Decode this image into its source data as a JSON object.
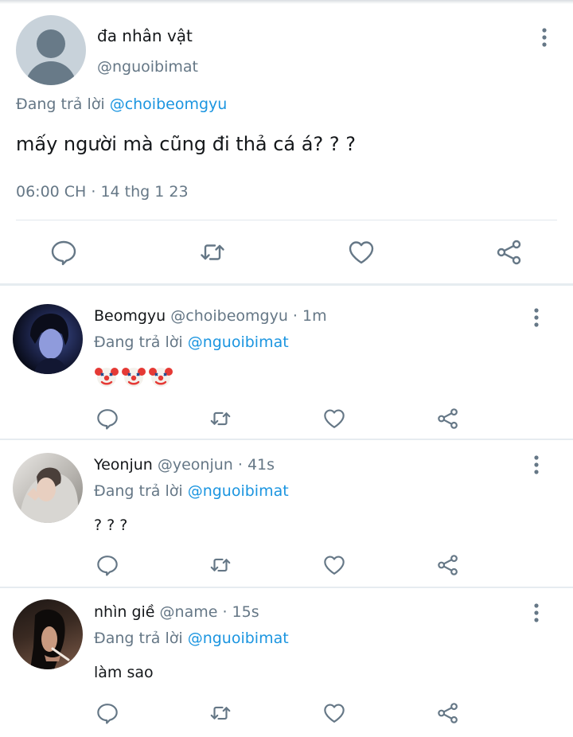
{
  "main_tweet": {
    "display_name": "đa nhân vật",
    "handle": "@nguoibimat",
    "reply_prefix": "Đang trả lời",
    "reply_to": "@choibeomgyu",
    "text": "mấy người mà cũng đi thả cá á? ? ?",
    "timestamp": "06:00 CH · 14 thg 1 23"
  },
  "replies": [
    {
      "display_name": "Beomgyu",
      "meta": "@choibeomgyu · 1m",
      "reply_prefix": "Đang trả lời",
      "reply_to": "@nguoibimat",
      "text": "",
      "emoji": [
        "clown-face",
        "clown-face",
        "clown-face"
      ]
    },
    {
      "display_name": "Yeonjun",
      "meta": "@yeonjun · 41s",
      "reply_prefix": "Đang trả lời",
      "reply_to": "@nguoibimat",
      "text": "? ? ?"
    },
    {
      "display_name": "nhìn giề",
      "meta": "@name · 15s",
      "reply_prefix": "Đang trả lời",
      "reply_to": "@nguoibimat",
      "text": "làm sao"
    }
  ],
  "actions": [
    "reply-icon",
    "retweet-icon",
    "like-icon",
    "share-icon"
  ],
  "colors": {
    "link": "#1b95e0",
    "secondary_text": "#657786",
    "icon": "#657786",
    "divider": "#e6ecf0"
  }
}
